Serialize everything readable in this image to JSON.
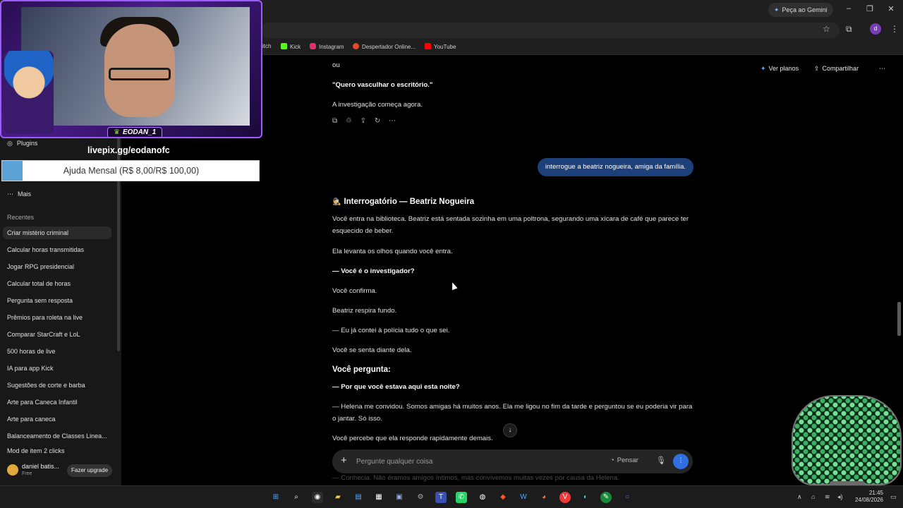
{
  "browser": {
    "gemini_button": "Peça ao Gemini",
    "bookmarks": [
      {
        "label": "itch",
        "color": "#9146ff"
      },
      {
        "label": "Kick",
        "color": "#53fc18"
      },
      {
        "label": "Instagram",
        "color": "#e1306c"
      },
      {
        "label": "Despertador Online...",
        "color": "#e04a2a"
      },
      {
        "label": "YouTube",
        "color": "#ff0000"
      }
    ],
    "profile_initial": "d"
  },
  "sidebar": {
    "plugins_label": "Plugins",
    "more_label": "Mais",
    "recents_heading": "Recentes",
    "recents": [
      "Criar mistério criminal",
      "Calcular horas transmitidas",
      "Jogar RPG presidencial",
      "Calcular total de horas",
      "Pergunta sem resposta",
      "Prêmios para roleta na live",
      "Comparar StarCraft e LoL",
      "500 horas de live",
      "IA para app Kick",
      "Sugestões de corte e barba",
      "Arte para Caneca Infantil",
      "Arte para caneca",
      "Balanceamento de Classes Linea...",
      "Mod de item 2 clicks"
    ],
    "user_name": "daniel batis...",
    "user_plan": "Free",
    "upgrade_label": "Fazer upgrade"
  },
  "header": {
    "plans_label": "Ver planos",
    "share_label": "Compartilhar"
  },
  "conversation": {
    "prev_or": "ou",
    "prev_quote": "\"Quero vasculhar o escritório.\"",
    "prev_end": "A investigação começa agora.",
    "user_message": "interrogue a beatriz nogueira, amiga da família.",
    "heading_emoji": "🕵️",
    "heading": "Interrogatório — Beatriz Nogueira",
    "p1": "Você entra na biblioteca. Beatriz está sentada sozinha em uma poltrona, segurando uma xícara de café que parece ter esquecido de beber.",
    "p2": "Ela levanta os olhos quando você entra.",
    "p3": "— Você é o investigador?",
    "p4": "Você confirma.",
    "p5": "Beatriz respira fundo.",
    "p6": "— Eu já contei à polícia tudo o que sei.",
    "p7": "Você se senta diante dela.",
    "subheading": "Você pergunta:",
    "q1": "— Por que você estava aqui esta noite?",
    "a1": "— Helena me convidou. Somos amigas há muitos anos. Ela me ligou no fim da tarde e perguntou se eu poderia vir para o jantar. Só isso.",
    "p8": "Você percebe que ela responde rapidamente demais.",
    "p9_faded": "— Conhecia. Não éramos amigos íntimos, mas convivemos muitas vezes por causa da Helena."
  },
  "composer": {
    "placeholder": "Pergunte qualquer coisa",
    "think_label": "Pensar"
  },
  "overlay": {
    "streamer_tag": "EODAN_1",
    "livepix": "livepix.gg/eodanofc",
    "goal_label": "Ajuda Mensal (R$ 8,00/R$ 100,00)",
    "goal_progress": 0.08
  },
  "taskbar": {
    "time": "21:45",
    "date": "24/08/2026"
  },
  "colors": {
    "accent": "#2f6fe0",
    "user_bubble": "#1d3f7a",
    "overlay_border": "#9b5cff",
    "goal_fill": "#5ba3d6"
  }
}
